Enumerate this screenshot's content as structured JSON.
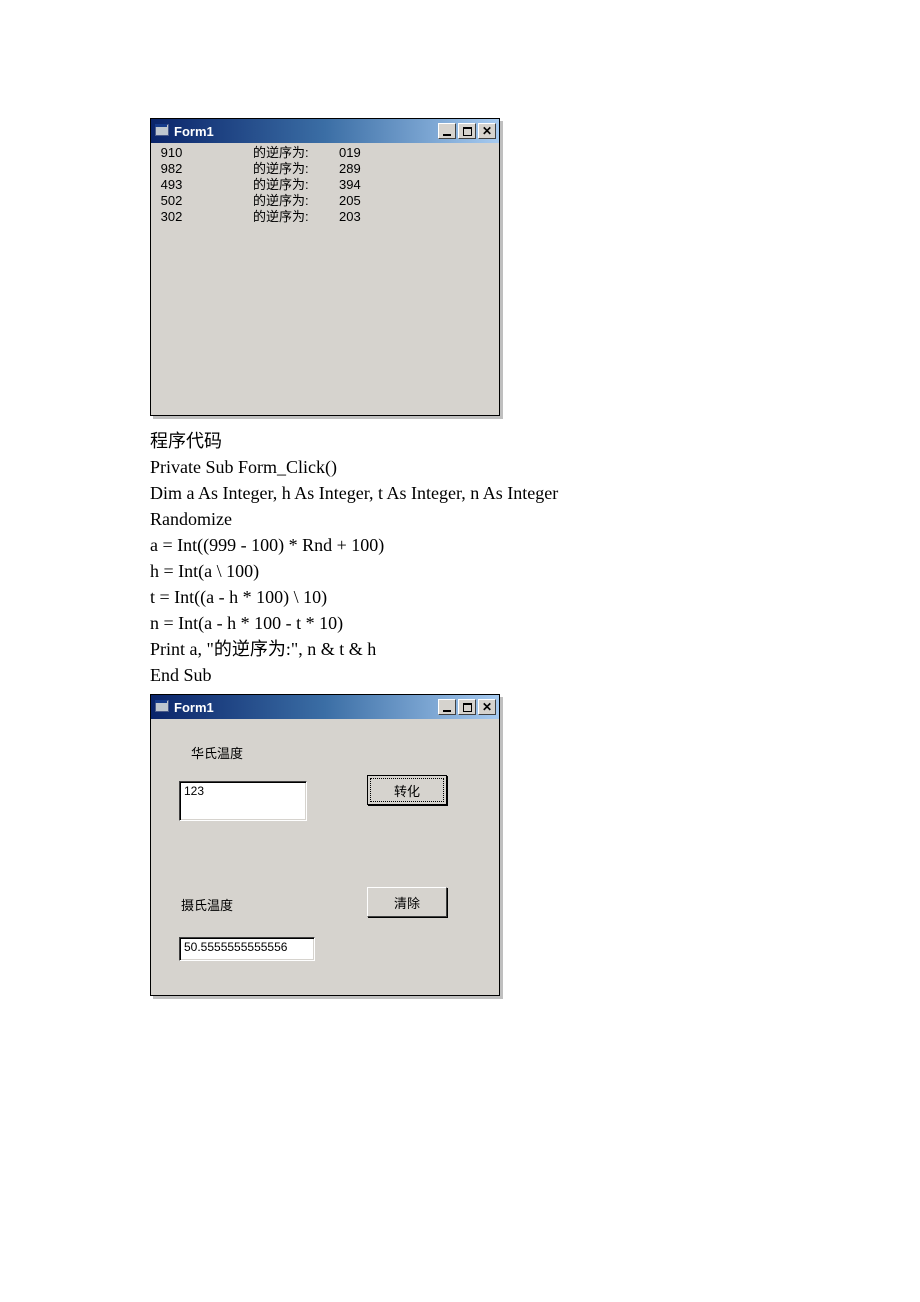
{
  "window1": {
    "title": "Form1",
    "rows": [
      {
        "num": " 910",
        "label": "的逆序为:",
        "rev": "019"
      },
      {
        "num": " 982",
        "label": "的逆序为:",
        "rev": "289"
      },
      {
        "num": " 493",
        "label": "的逆序为:",
        "rev": "394"
      },
      {
        "num": " 502",
        "label": "的逆序为:",
        "rev": "205"
      },
      {
        "num": " 302",
        "label": "的逆序为:",
        "rev": "203"
      }
    ]
  },
  "code": {
    "heading": "程序代码",
    "lines": [
      "Private Sub Form_Click()",
      "Dim a As Integer, h As Integer, t As Integer, n As Integer",
      "Randomize",
      "a = Int((999 - 100) * Rnd + 100)",
      "h = Int(a \\ 100)",
      "t = Int((a - h * 100) \\ 10)",
      "n = Int(a - h * 100 - t * 10)",
      "Print a, \"的逆序为:\", n & t & h",
      "End Sub"
    ]
  },
  "window2": {
    "title": "Form1",
    "label_f": "华氏温度",
    "label_c": "摄氏温度",
    "input_f": "123",
    "input_c": "50.5555555555556",
    "btn_convert": "转化",
    "btn_clear": "清除"
  }
}
